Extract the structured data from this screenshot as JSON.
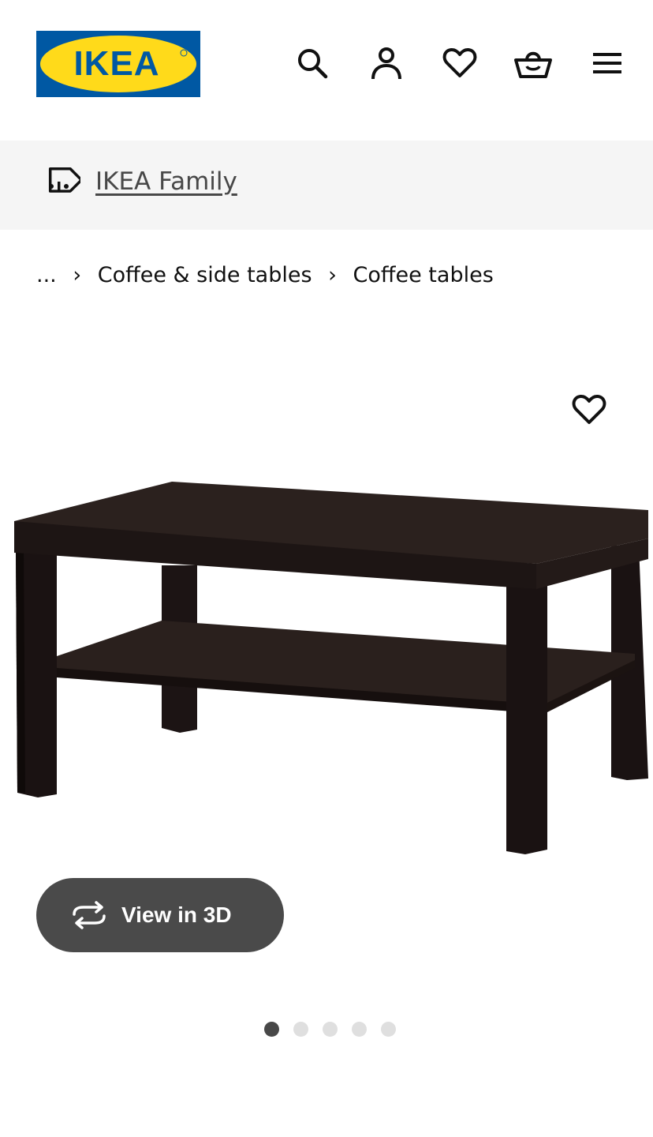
{
  "header": {
    "logo_text": "IKEA",
    "logo_colors": {
      "blue": "#0058A3",
      "yellow": "#FFDA1A"
    },
    "icons": [
      "search-icon",
      "account-icon",
      "heart-icon",
      "basket-icon",
      "menu-icon"
    ]
  },
  "family": {
    "icon": "family-tag-icon",
    "link": "IKEA Family"
  },
  "breadcrumb": {
    "ellipsis": "...",
    "items": [
      "Coffee & side tables",
      "Coffee tables"
    ],
    "separator": "›"
  },
  "product": {
    "favorite_icon": "heart-outline-icon",
    "image": "coffee-table-image",
    "view3d": {
      "icon": "rotate-3d-icon",
      "label": "View in 3D"
    },
    "gallery": {
      "count": 5,
      "active": 1
    }
  },
  "colors": {
    "text": "#111111",
    "family_bar_bg": "#f5f5f5",
    "view3d_bg": "#4a4a4a",
    "dot_active": "#484848",
    "dot_inactive": "#dfdfdf"
  }
}
